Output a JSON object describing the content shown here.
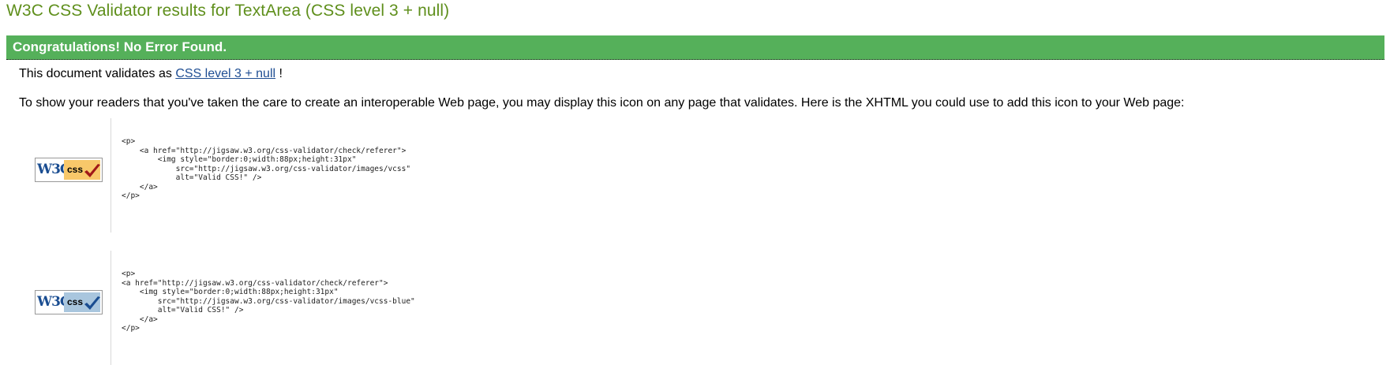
{
  "page": {
    "title": "W3C CSS Validator results for TextArea (CSS level 3 + null)"
  },
  "banner": {
    "text": "Congratulations! No Error Found."
  },
  "validation": {
    "prefix": "This document validates as ",
    "link_text": "CSS level 3 + null",
    "suffix": " !"
  },
  "readers_text": "To show your readers that you've taken the care to create an interoperable Web page, you may display this icon on any page that validates. Here is the XHTML you could use to add this icon to your Web page:",
  "badges": [
    {
      "variant": "gold",
      "w3c_text": "W3C",
      "css_text": "css",
      "check_color": "#a01818",
      "code": "<p>\n    <a href=\"http://jigsaw.w3.org/css-validator/check/referer\">\n        <img style=\"border:0;width:88px;height:31px\"\n            src=\"http://jigsaw.w3.org/css-validator/images/vcss\"\n            alt=\"Valid CSS!\" />\n    </a>\n</p>"
    },
    {
      "variant": "blue",
      "w3c_text": "W3C",
      "css_text": "css",
      "check_color": "#1a4d91",
      "code": "<p>\n<a href=\"http://jigsaw.w3.org/css-validator/check/referer\">\n    <img style=\"border:0;width:88px;height:31px\"\n        src=\"http://jigsaw.w3.org/css-validator/images/vcss-blue\"\n        alt=\"Valid CSS!\" />\n    </a>\n</p>"
    }
  ],
  "colors": {
    "title": "#5f8f1c",
    "banner_bg": "#55b05a",
    "link": "#1f4e93"
  }
}
